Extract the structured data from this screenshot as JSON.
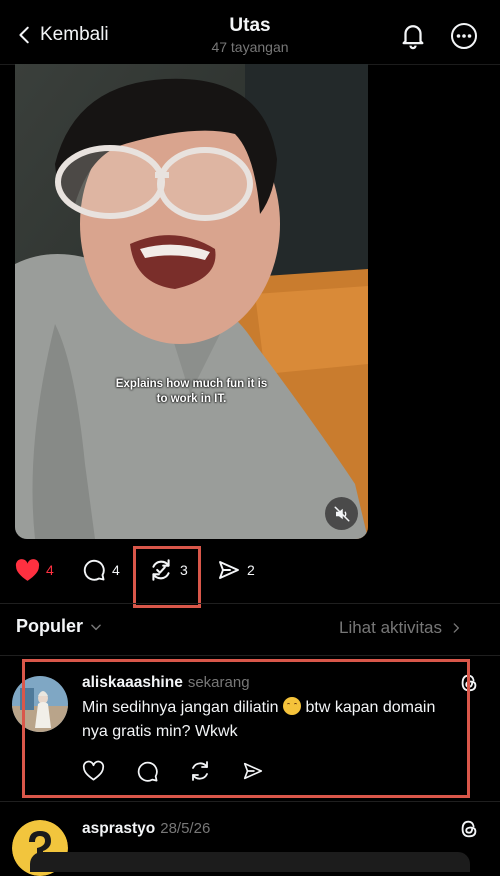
{
  "header": {
    "back_label": "Kembali",
    "title": "Utas",
    "subtitle": "47 tayangan"
  },
  "video": {
    "caption": "Explains how much fun it is\nto work in IT."
  },
  "actions": {
    "likes": "4",
    "comments": "4",
    "reposts": "3",
    "shares": "2",
    "like_color": "#ff3040"
  },
  "sort": {
    "label": "Populer",
    "activity_link": "Lihat aktivitas"
  },
  "comments": [
    {
      "username": "aliskaaashine",
      "time": "sekarang",
      "text_line1_before": "Min sedihnya jangan diliatin",
      "text_line1_after": "btw kapan domain",
      "text_line2": "nya gratis min? Wkwk"
    },
    {
      "username": "asprastyo",
      "time": "28/5/26"
    }
  ],
  "highlight_color": "#d9574a",
  "icons": [
    "chevron-left-icon",
    "bell-icon",
    "more-icon",
    "mute-icon",
    "heart-icon",
    "comment-icon",
    "repost-icon",
    "share-icon",
    "chevron-down-icon",
    "chevron-right-icon",
    "threads-icon",
    "emoji-icon"
  ]
}
